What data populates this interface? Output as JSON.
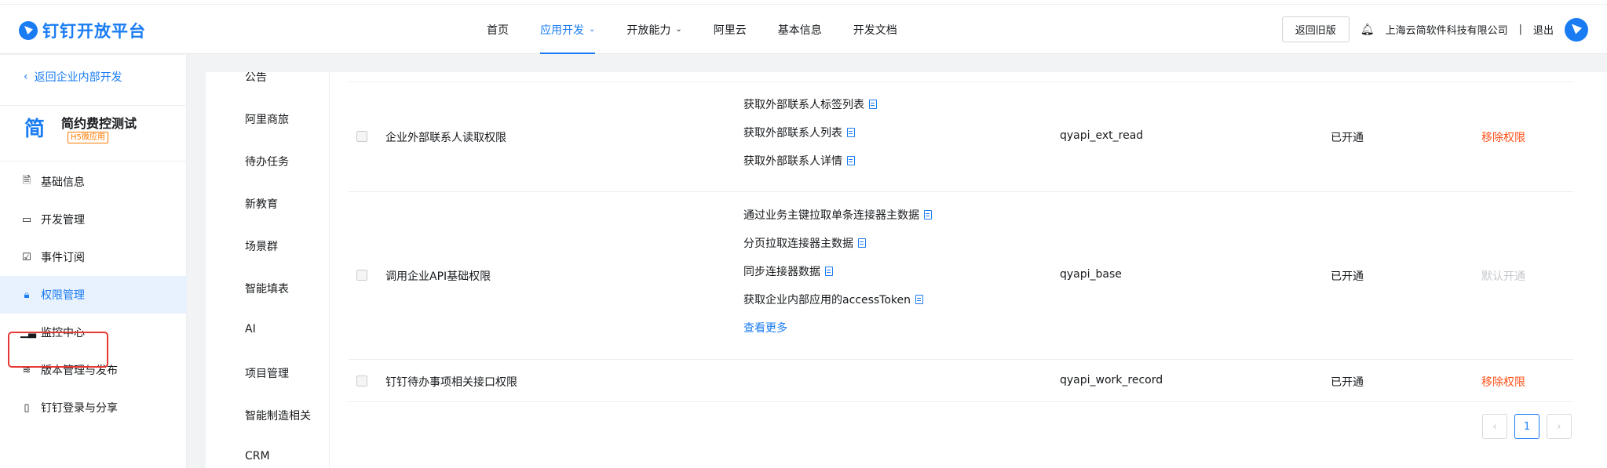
{
  "header": {
    "logo_text": "钉钉开放平台",
    "nav": [
      {
        "label": "首页",
        "active": false,
        "dropdown": false
      },
      {
        "label": "应用开发",
        "active": true,
        "dropdown": true
      },
      {
        "label": "开放能力",
        "active": false,
        "dropdown": true
      },
      {
        "label": "阿里云",
        "active": false,
        "dropdown": false
      },
      {
        "label": "基本信息",
        "active": false,
        "dropdown": false
      },
      {
        "label": "开发文档",
        "active": false,
        "dropdown": false
      }
    ],
    "old_version_btn": "返回旧版",
    "company": "上海云简软件科技有限公司",
    "separator": "|",
    "logout": "退出"
  },
  "sidebar": {
    "back_link": "返回企业内部开发",
    "app_icon": "简",
    "app_name": "简约费控测试",
    "app_tag": "H5微应用",
    "items": [
      {
        "label": "基础信息",
        "icon": "doc-icon"
      },
      {
        "label": "开发管理",
        "icon": "monitor-icon"
      },
      {
        "label": "事件订阅",
        "icon": "calendar-check-icon"
      },
      {
        "label": "权限管理",
        "icon": "lock-icon",
        "active": true
      },
      {
        "label": "监控中心",
        "icon": "bar-chart-icon"
      },
      {
        "label": "版本管理与发布",
        "icon": "layers-icon"
      },
      {
        "label": "钉钉登录与分享",
        "icon": "phone-share-icon"
      }
    ]
  },
  "categories": [
    "公告",
    "阿里商旅",
    "待办任务",
    "新教育",
    "场景群",
    "智能填表",
    "AI",
    "项目管理",
    "智能制造相关",
    "CRM"
  ],
  "permissions": [
    {
      "name": "企业外部联系人读取权限",
      "apis": [
        "获取外部联系人标签列表",
        "获取外部联系人列表",
        "获取外部联系人详情"
      ],
      "more": "",
      "code": "qyapi_ext_read",
      "status": "已开通",
      "action": "移除权限",
      "action_type": "red"
    },
    {
      "name": "调用企业API基础权限",
      "apis": [
        "通过业务主键拉取单条连接器主数据",
        "分页拉取连接器主数据",
        "同步连接器数据",
        "获取企业内部应用的accessToken"
      ],
      "more": "查看更多",
      "code": "qyapi_base",
      "status": "已开通",
      "action": "默认开通",
      "action_type": "gray"
    },
    {
      "name": "钉钉待办事项相关接口权限",
      "apis": [],
      "more": "",
      "code": "qyapi_work_record",
      "status": "已开通",
      "action": "移除权限",
      "action_type": "red"
    }
  ],
  "pager": {
    "prev": "‹",
    "current": "1",
    "next": "›"
  },
  "colors": {
    "accent": "#1a7cf3",
    "danger": "#ff5219",
    "disabled": "#c5c8cc",
    "highlight": "#e53935"
  }
}
